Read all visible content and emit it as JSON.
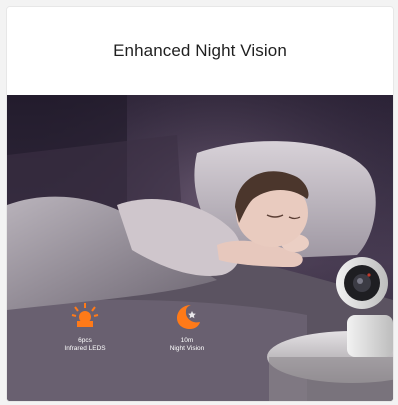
{
  "card": {
    "title": "Enhanced Night Vision"
  },
  "features": [
    {
      "icon": "infrared-led-icon",
      "line1": "6pcs",
      "line2": "Infrared LEDS"
    },
    {
      "icon": "moon-night-icon",
      "line1": "10m",
      "line2": "Night Vision"
    }
  ],
  "colors": {
    "accent": "#ff7a18",
    "title_text": "#1f1f1f",
    "scene_dark": "#2b2236"
  }
}
